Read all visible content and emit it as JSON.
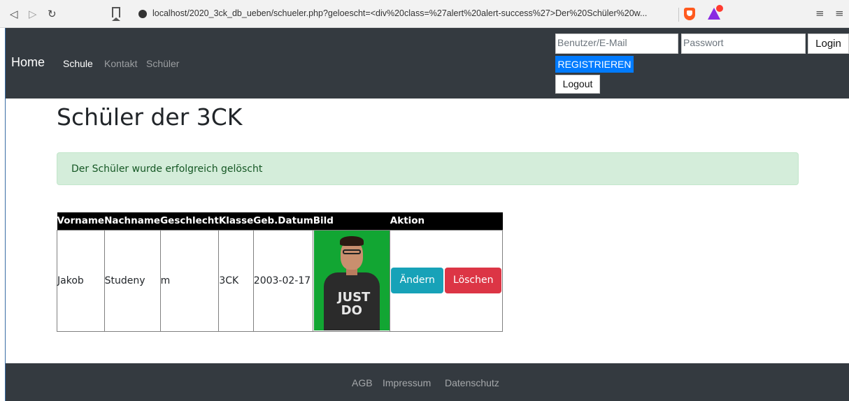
{
  "browser": {
    "url": "localhost/2020_3ck_db_ueben/schueler.php?geloescht=<div%20class=%27alert%20alert-success%27>Der%20Schüler%20w..."
  },
  "navbar": {
    "brand": "Home",
    "links": [
      "Schule",
      "Kontakt",
      "Schüler"
    ],
    "user_placeholder": "Benutzer/E-Mail",
    "password_placeholder": "Passwort",
    "login_label": "Login",
    "register_label": "REGISTRIEREN",
    "logout_label": "Logout"
  },
  "main": {
    "title": "Schüler der 3CK",
    "alert": "Der Schüler wurde erfolgreich gelöscht",
    "table": {
      "headers": [
        "Vorname",
        "Nachname",
        "Geschlecht",
        "Klasse",
        "Geb.Datum",
        "Bild",
        "Aktion"
      ],
      "rows": [
        {
          "vorname": "Jakob",
          "nachname": "Studeny",
          "geschlecht": "m",
          "klasse": "3CK",
          "geburtsdatum": "2003-02-17",
          "shirt_text": "JUST DO",
          "edit_label": "Ändern",
          "delete_label": "Löschen"
        }
      ]
    }
  },
  "footer": {
    "links": [
      "AGB",
      "Impressum",
      "Datenschutz"
    ]
  },
  "colors": {
    "navbar_bg": "#343a40",
    "primary": "#007bff",
    "info": "#17a2b8",
    "danger": "#dc3545",
    "alert_bg": "#d4edda",
    "alert_text": "#155724"
  }
}
